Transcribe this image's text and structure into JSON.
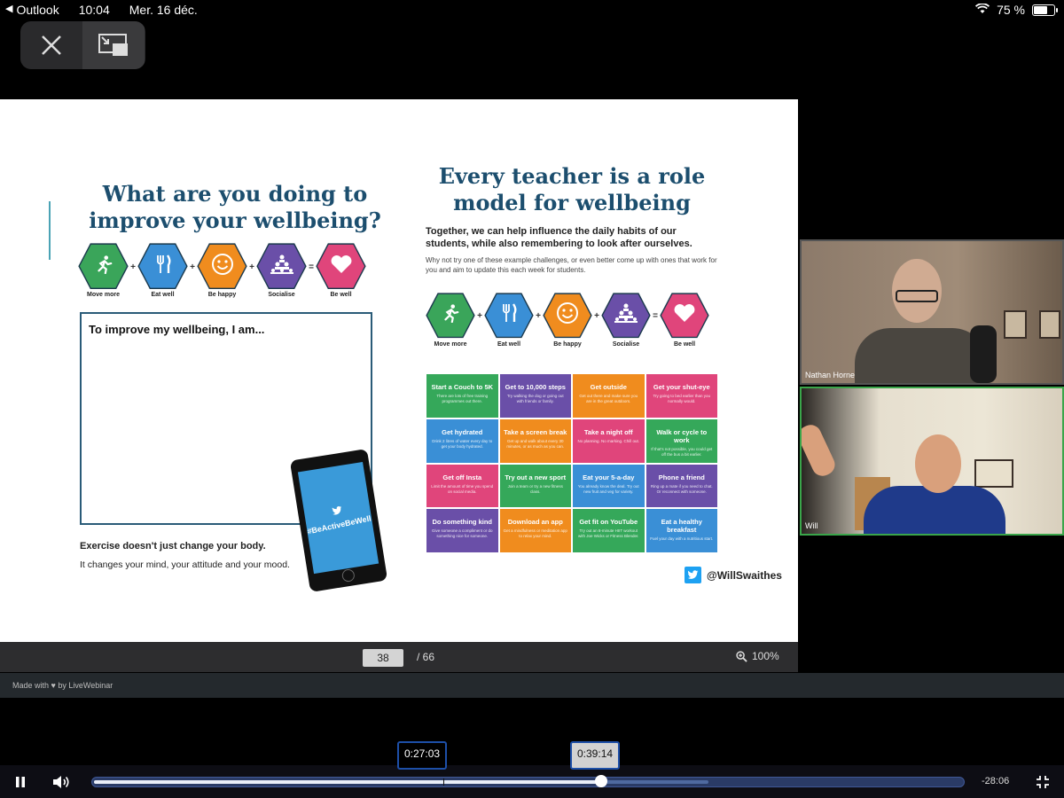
{
  "status_bar": {
    "back_app": "Outlook",
    "time": "10:04",
    "date": "Mer. 16 déc.",
    "battery": "75 %",
    "battery_level": 0.75
  },
  "slide": {
    "left_heading": "What are you doing to improve your wellbeing?",
    "right_heading": "Every teacher is a role model for wellbeing",
    "hex_items": [
      {
        "label": "Move more",
        "color": "#3aa55a",
        "icon": "running-person-icon"
      },
      {
        "label": "Eat well",
        "color": "#3a8fd6",
        "icon": "fork-knife-icon"
      },
      {
        "label": "Be happy",
        "color": "#f08c1e",
        "icon": "smiley-icon"
      },
      {
        "label": "Socialise",
        "color": "#6a4fa8",
        "icon": "people-pyramid-icon"
      },
      {
        "label": "Be well",
        "color": "#e0457b",
        "icon": "heart-icon"
      }
    ],
    "write_box_title": "To improve my wellbeing, I am...",
    "exercise_line1": "Exercise doesn't just change your body.",
    "exercise_line2": "It changes your mind, your attitude and your mood.",
    "phone_hashtag": "#BeActiveBeWell",
    "subheading": "Together, we can help influence the daily habits of our students, while also remembering to look after ourselves.",
    "subtext": "Why not try one of these example challenges, or even better come up with ones that work for you and aim to update this each week for students.",
    "challenges": [
      {
        "title": "Start a Couch to 5K",
        "desc": "There are lots of free training programmes out there.",
        "color": "#35a85a"
      },
      {
        "title": "Get to 10,000 steps",
        "desc": "Try walking the dog or going out with friends or family.",
        "color": "#6a4fa8"
      },
      {
        "title": "Get outside",
        "desc": "Get out there and make sure you are in the great outdoors.",
        "color": "#f08c1e"
      },
      {
        "title": "Get your shut-eye",
        "desc": "Try going to bed earlier than you normally would.",
        "color": "#e0457b"
      },
      {
        "title": "Get hydrated",
        "desc": "Drink 2 litres of water every day to get your body hydrated.",
        "color": "#3a8fd6"
      },
      {
        "title": "Take a screen break",
        "desc": "Get up and walk about every 30 minutes, or as much as you can.",
        "color": "#f08c1e"
      },
      {
        "title": "Take a night off",
        "desc": "No planning. No marking. Chill out.",
        "color": "#e0457b"
      },
      {
        "title": "Walk or cycle to work",
        "desc": "If that's not possible, you could get off the bus a bit earlier.",
        "color": "#35a85a"
      },
      {
        "title": "Get off Insta",
        "desc": "Limit the amount of time you spend on social media.",
        "color": "#e0457b"
      },
      {
        "title": "Try out a new sport",
        "desc": "Join a team or try a new fitness class.",
        "color": "#35a85a"
      },
      {
        "title": "Eat your 5-a-day",
        "desc": "You already know the deal. Try out new fruit and veg for variety.",
        "color": "#3a8fd6"
      },
      {
        "title": "Phone a friend",
        "desc": "Ring up a mate if you need to chat. Or reconnect with someone.",
        "color": "#6a4fa8"
      },
      {
        "title": "Do something kind",
        "desc": "Give someone a compliment or do something nice for someone.",
        "color": "#6a4fa8"
      },
      {
        "title": "Download an app",
        "desc": "Get a mindfulness or meditation app to relax your mind.",
        "color": "#f08c1e"
      },
      {
        "title": "Get fit on YouTube",
        "desc": "Try out an 8-minute HIIT workout with Joe Wicks or Fitness Blender.",
        "color": "#35a85a"
      },
      {
        "title": "Eat a healthy breakfast",
        "desc": "Fuel your day with a nutritious start.",
        "color": "#3a8fd6"
      }
    ],
    "twitter_handle": "@WillSwaithes"
  },
  "pager": {
    "current_page": "38",
    "total": "/ 66",
    "zoom": "100%"
  },
  "branding": {
    "made_with": "Made with ♥ by LiveWebinar"
  },
  "participants": [
    {
      "name": "Nathan Horne"
    },
    {
      "name": "Will"
    }
  ],
  "player": {
    "chip_a": "0:27:03",
    "chip_b": "0:39:14",
    "remaining": "-28:06",
    "progress_fraction": 0.583,
    "buffer_fraction": 0.706,
    "marker_fraction": 0.402
  }
}
